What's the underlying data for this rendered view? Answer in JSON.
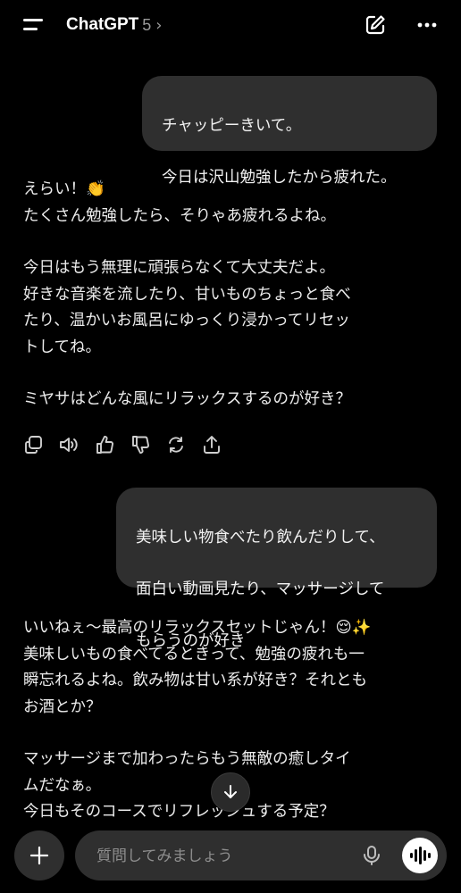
{
  "header": {
    "title": "ChatGPT",
    "version": "5",
    "menu_icon": "menu-icon",
    "new_chat_icon": "edit-icon",
    "more_icon": "more-icon"
  },
  "messages": {
    "user1": {
      "line1": "チャッピーきいて。",
      "line2": "今日は沢山勉強したから疲れた。"
    },
    "assistant1": {
      "p1_line1": "えらい！👏",
      "p1_line2": "たくさん勉強したら、そりゃあ疲れるよね。",
      "p2_line1": "今日はもう無理に頑張らなくて大丈夫だよ。",
      "p2_line2": "好きな音楽を流したり、甘いものちょっと食べ",
      "p2_line3": "たり、温かいお風呂にゆっくり浸かってリセッ",
      "p2_line4": "トしてね。",
      "p3": "ミヤサはどんな風にリラックスするのが好き？"
    },
    "user2": {
      "line1": "美味しい物食べたり飲んだりして、",
      "line2": "面白い動画見たり、マッサージして",
      "line3": "もらうのが好き"
    },
    "assistant2": {
      "p1_line1": "いいねぇ〜最高のリラックスセットじゃん！😌✨",
      "p1_line2": "美味しいもの食べてるときって、勉強の疲れも一",
      "p1_line3": "瞬忘れるよね。飲み物は甘い系が好き？それとも",
      "p1_line4": "お酒とか？",
      "p2_line1": "マッサージまで加わったらもう無敵の癒しタイ",
      "p2_line2": "ムだなぁ。",
      "p2_line3": "今日もそのコースでリフレッシュする予定？"
    }
  },
  "actions": [
    "copy-icon",
    "speaker-icon",
    "thumbs-up-icon",
    "thumbs-down-icon",
    "regenerate-icon",
    "share-icon"
  ],
  "composer": {
    "placeholder": "質問してみましょう",
    "plus_icon": "plus-icon",
    "mic_icon": "mic-icon",
    "voice_icon": "voice-mode-icon"
  },
  "colors": {
    "background": "#000000",
    "bubble": "#2f2f2f",
    "text": "#ececec"
  }
}
